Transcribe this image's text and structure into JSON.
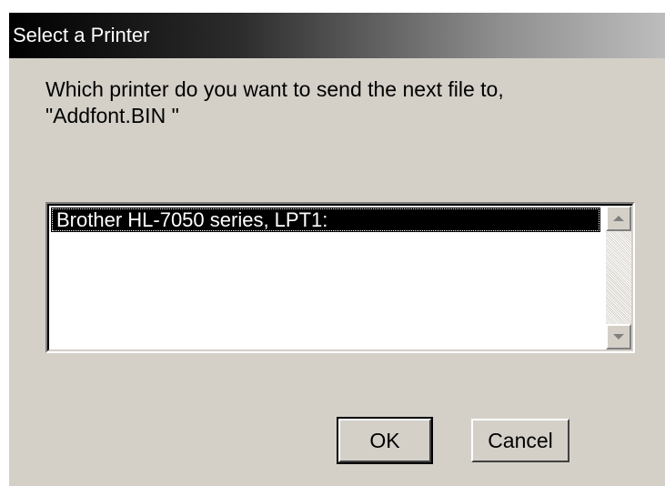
{
  "dialog": {
    "title": "Select a Printer",
    "prompt_line1": "Which printer do you want to send the next file to,",
    "prompt_line2": "\"Addfont.BIN \"",
    "printers": [
      {
        "label": "Brother HL-7050 series, LPT1:",
        "selected": true
      }
    ],
    "ok_label": "OK",
    "cancel_label": "Cancel"
  },
  "icons": {
    "scroll_up": "scroll-up-arrow-icon",
    "scroll_down": "scroll-down-arrow-icon"
  },
  "colors": {
    "dialog_face": "#d4d0c8",
    "selection_bg": "#000000",
    "selection_text": "#ffffff"
  }
}
